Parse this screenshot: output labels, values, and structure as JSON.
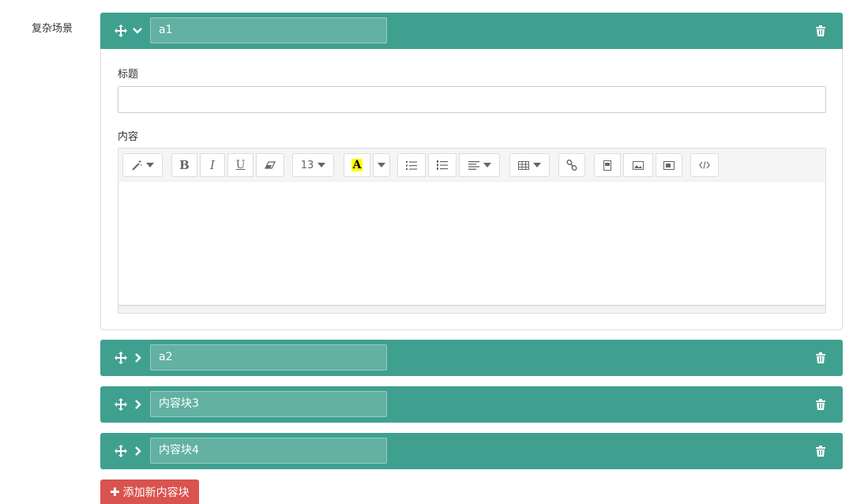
{
  "field_label": "复杂场景",
  "blocks": [
    {
      "title": "a1",
      "expanded": true,
      "subtitle_label": "标题",
      "content_label": "内容"
    },
    {
      "title": "a2",
      "expanded": false
    },
    {
      "title": "内容块3",
      "expanded": false
    },
    {
      "title": "内容块4",
      "expanded": false
    }
  ],
  "editor": {
    "font_size": "13",
    "highlight_letter": "A",
    "bold": "B",
    "italic": "I",
    "underline": "U"
  },
  "add_button_label": "添加新内容块",
  "colors": {
    "header": "#40a08f",
    "danger": "#d9534f"
  }
}
